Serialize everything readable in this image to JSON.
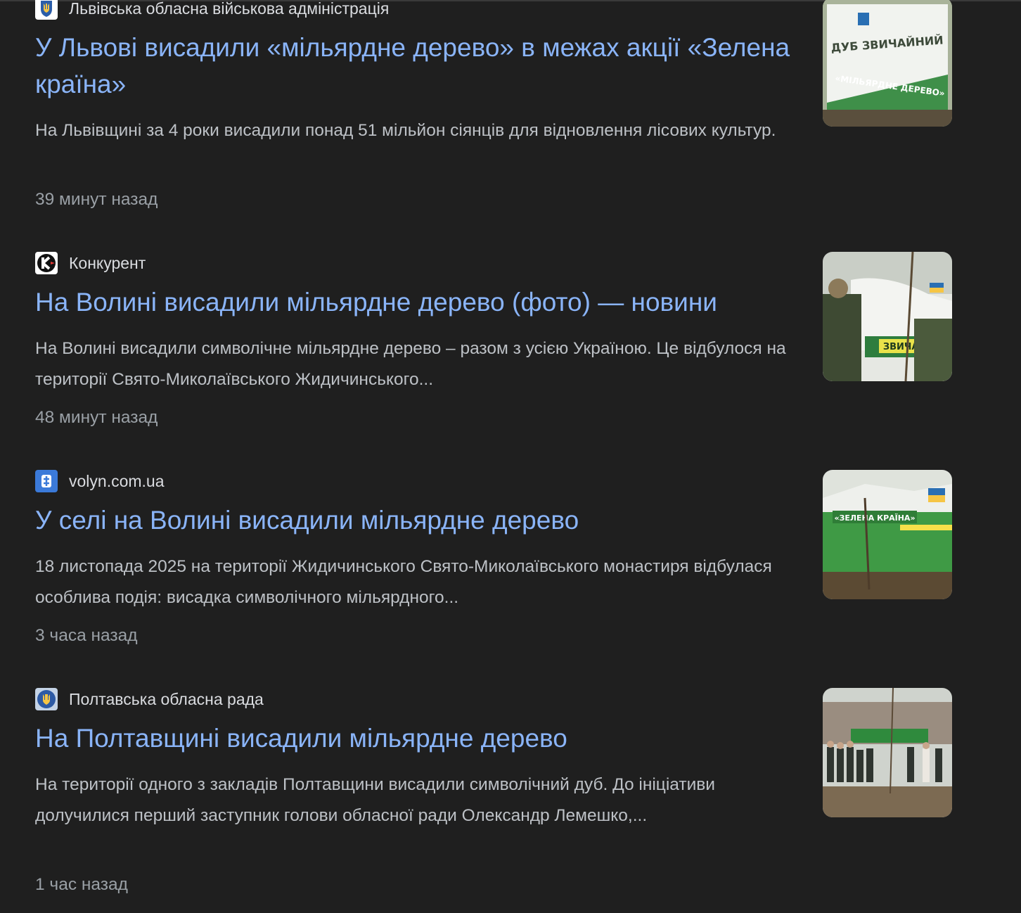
{
  "results": [
    {
      "source": "Львівська обласна військова адміністрація",
      "favicon_icon": "ukraine-trident-shield-icon",
      "title": "У Львові висадили «мільярдне дерево» в межах акції «Зелена країна»",
      "snippet": "На Львівщині за 4 роки висадили понад 51 мільйон сіянців для відновлення лісових культур.",
      "time": "39 минут назад",
      "thumb_text": [
        "ДУБ ЗВИЧАЙНИЙ",
        "«МІЛЬЯРДНЕ ДЕРЕВО»"
      ]
    },
    {
      "source": "Конкурент",
      "favicon_icon": "konkurent-logo-icon",
      "title": "На Волині висадили мільярдне дерево (фото) — новини",
      "snippet": "На Волині висадили символічне мільярдне дерево – разом з усією Україною. Це відбулося на території Свято-Миколаївського Жидичинського...",
      "time": "48 минут назад",
      "thumb_text": [
        "ЗВИЧАЙНОЇ"
      ]
    },
    {
      "source": "volyn.com.ua",
      "favicon_icon": "volyn-logo-icon",
      "title": "У селі на Волині висадили мільярдне дерево",
      "snippet": "18 листопада 2025 на території Жидичинського Свято-Миколаївського монастиря відбулася особлива подія: висадка символічного мільярдного...",
      "time": "3 часа назад",
      "thumb_text": [
        "«ЗЕЛЕНА КРАЇНА»"
      ]
    },
    {
      "source": "Полтавська обласна рада",
      "favicon_icon": "poltava-coat-of-arms-icon",
      "title": "На Полтавщині висадили мільярдне дерево",
      "snippet": "На території одного з закладів Полтавщини висадили символічний дуб. До ініціативи долучилися перший заступник голови обласної ради Олександр Лемешко,...",
      "time": "1 час назад",
      "thumb_text": []
    }
  ],
  "colors": {
    "background": "#1f1f1f",
    "link": "#8ab4f8",
    "snippet": "#bdc1c6",
    "timestamp": "#9aa0a6",
    "source": "#dadce0"
  }
}
